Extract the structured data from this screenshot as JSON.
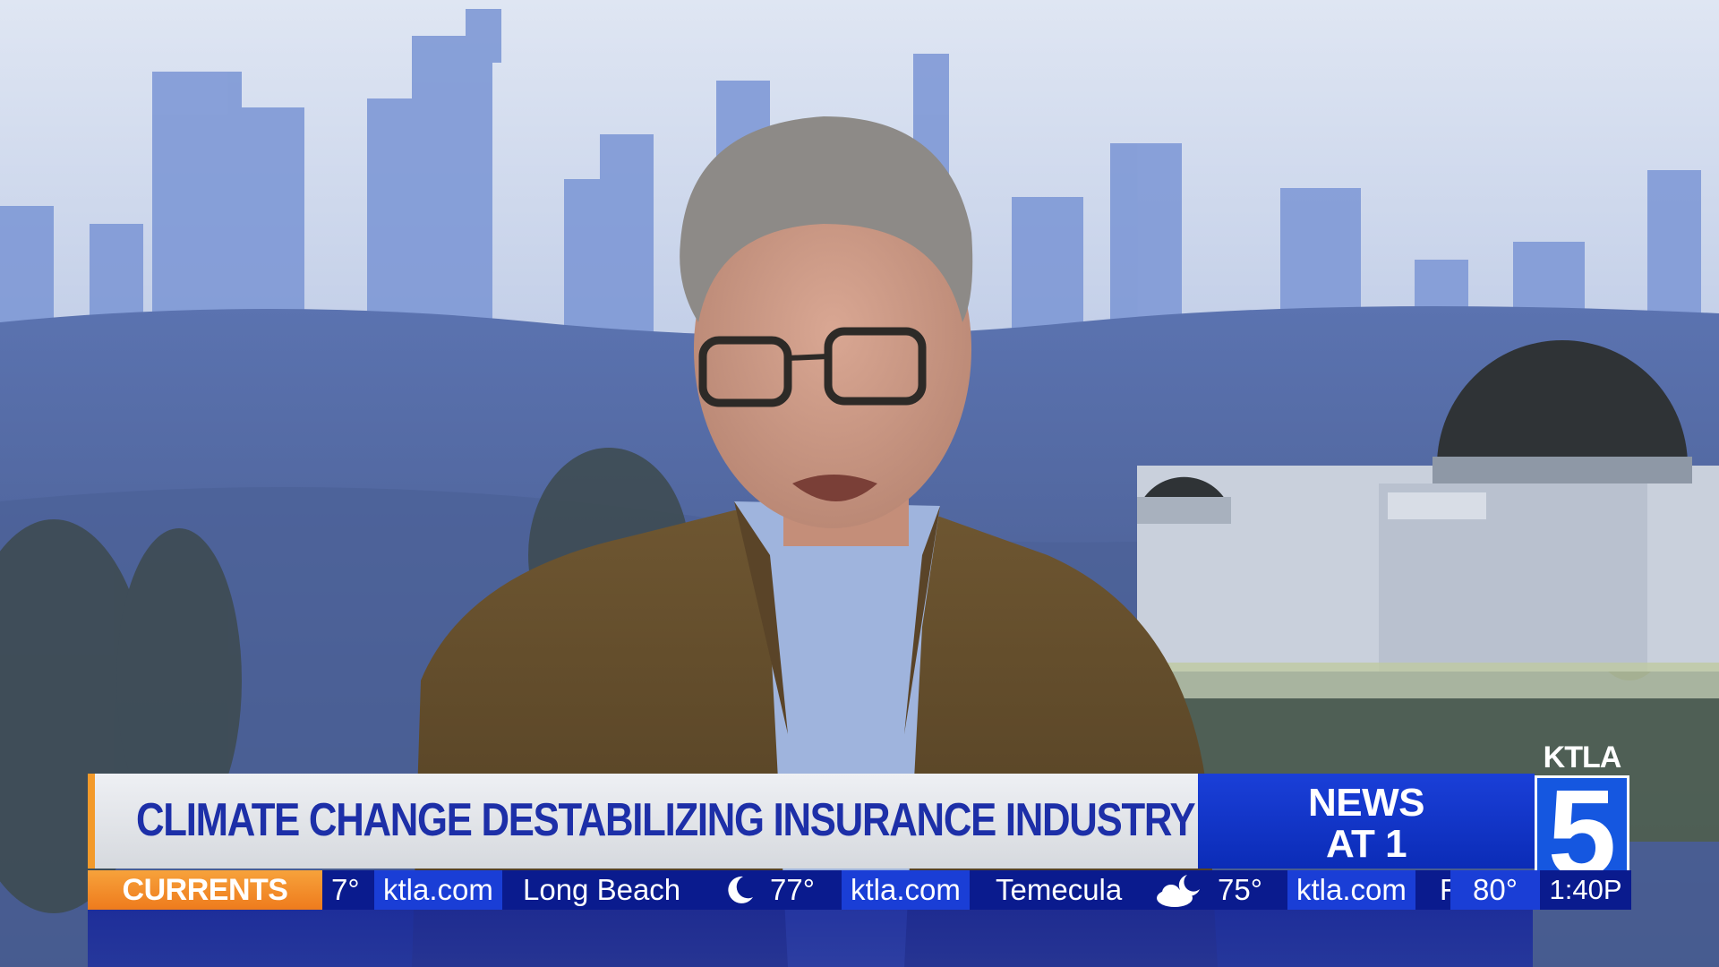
{
  "headline": "CLIMATE CHANGE DESTABILIZING INSURANCE INDUSTRY",
  "show": {
    "line1": "NEWS",
    "line2": "AT 1"
  },
  "logo": {
    "word": "KTLA",
    "number": "5",
    "color": "#1557e0"
  },
  "ticker": {
    "label": "CURRENTS",
    "items": [
      {
        "kind": "temp",
        "text": "7°"
      },
      {
        "kind": "site",
        "text": "ktla.com"
      },
      {
        "kind": "city",
        "text": "Long Beach"
      },
      {
        "kind": "icon",
        "icon": "moon-icon"
      },
      {
        "kind": "temp",
        "text": "77°"
      },
      {
        "kind": "site",
        "text": "ktla.com"
      },
      {
        "kind": "city",
        "text": "Temecula"
      },
      {
        "kind": "icon",
        "icon": "partly-cloudy-night-icon"
      },
      {
        "kind": "temp",
        "text": "75°"
      },
      {
        "kind": "site",
        "text": "ktla.com"
      },
      {
        "kind": "city",
        "text": "F"
      }
    ],
    "current_temp": "80°",
    "time": "1:40P"
  },
  "colors": {
    "accent_orange": "#f39a2a",
    "headline_text": "#1d2fa8",
    "ticker_bg": "#0a1b8e",
    "site_bg": "#1a3ed6"
  }
}
